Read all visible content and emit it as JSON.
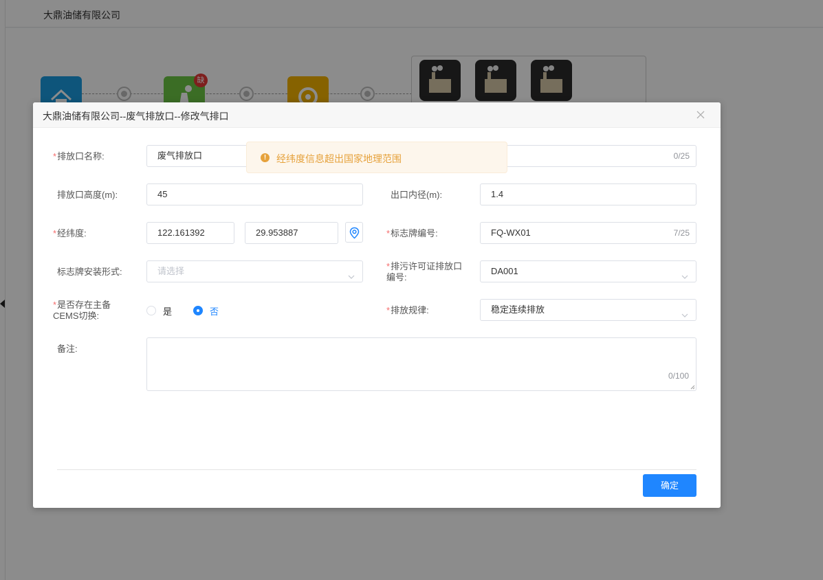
{
  "background": {
    "company_name": "大鼎油储有限公司",
    "missing_badge": "缺"
  },
  "dialog": {
    "title": "大鼎油储有限公司--废气排放口--修改气排口",
    "fields": {
      "outlet_name": {
        "label": "排放口名称:",
        "value": "废气排放口",
        "count": "0/25",
        "required": true
      },
      "outlet_height": {
        "label": "排放口高度(m):",
        "value": "45"
      },
      "outlet_diameter": {
        "label": "出口内径(m):",
        "value": "1.4"
      },
      "lnglat": {
        "label": "经纬度:",
        "longitude": "122.161392",
        "latitude": "29.953887",
        "required": true
      },
      "sign_number": {
        "label": "标志牌编号:",
        "value": "FQ-WX01",
        "count": "7/25",
        "required": true
      },
      "sign_install": {
        "label": "标志牌安装形式:",
        "placeholder": "请选择"
      },
      "permit_number": {
        "label": "排污许可证排放口编号:",
        "value": "DA001",
        "required": true
      },
      "cems_switch": {
        "label": "是否存在主备CEMS切换:",
        "options": [
          "是",
          "否"
        ],
        "selected": "否",
        "required": true
      },
      "emission_pattern": {
        "label": "排放规律:",
        "value": "稳定连续排放",
        "required": true
      },
      "remark": {
        "label": "备注:",
        "value": "",
        "count": "0/100"
      }
    },
    "confirm_label": "确定"
  },
  "toast": {
    "type": "warning",
    "message": "经纬度信息超出国家地理范围"
  },
  "colors": {
    "primary": "#1f86ff",
    "warning": "#e6a23c",
    "required": "#f56c6c"
  }
}
